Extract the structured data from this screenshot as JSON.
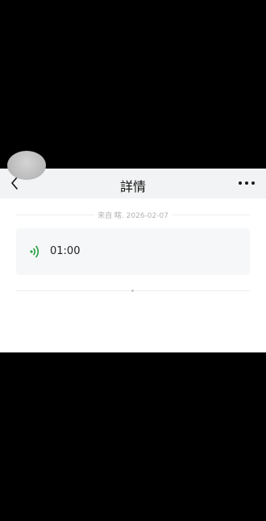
{
  "nav": {
    "title": "詳情",
    "back_icon": "chevron-left-icon",
    "more_icon": "more-horizontal-icon"
  },
  "message": {
    "meta": "来自 瞎. 2026-02-07",
    "duration": "01:00",
    "voice_icon": "voice-wave-icon",
    "accent_color": "#2ba245"
  }
}
